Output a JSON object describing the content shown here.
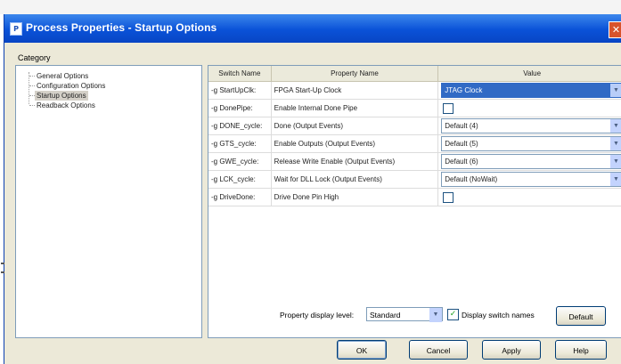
{
  "window": {
    "title": "Process Properties - Startup Options",
    "close_label": "✕"
  },
  "category": {
    "label": "Category",
    "items": [
      {
        "label": "General Options",
        "selected": false
      },
      {
        "label": "Configuration Options",
        "selected": false
      },
      {
        "label": "Startup Options",
        "selected": true
      },
      {
        "label": "Readback Options",
        "selected": false
      }
    ]
  },
  "grid": {
    "headers": {
      "switch_name": "Switch Name",
      "property_name": "Property Name",
      "value": "Value"
    },
    "rows": [
      {
        "switch": "-g StartUpClk:",
        "property": "FPGA Start-Up Clock",
        "value_type": "select",
        "value": "JTAG Clock",
        "highlighted": true
      },
      {
        "switch": "-g DonePipe:",
        "property": "Enable Internal Done Pipe",
        "value_type": "checkbox",
        "checked": false
      },
      {
        "switch": "-g DONE_cycle:",
        "property": "Done (Output Events)",
        "value_type": "select",
        "value": "Default (4)"
      },
      {
        "switch": "-g GTS_cycle:",
        "property": "Enable Outputs (Output Events)",
        "value_type": "select",
        "value": "Default (5)"
      },
      {
        "switch": "-g GWE_cycle:",
        "property": "Release Write Enable (Output Events)",
        "value_type": "select",
        "value": "Default (6)"
      },
      {
        "switch": "-g LCK_cycle:",
        "property": "Wait for DLL Lock (Output Events)",
        "value_type": "select",
        "value": "Default (NoWait)"
      },
      {
        "switch": "-g DriveDone:",
        "property": "Drive Done Pin High",
        "value_type": "checkbox",
        "checked": false
      }
    ]
  },
  "footer": {
    "display_level_label": "Property display level:",
    "display_level_value": "Standard",
    "display_switch_names_label": "Display switch names",
    "display_switch_names_checked": true,
    "default_button": "Default",
    "ok_button": "OK",
    "cancel_button": "Cancel",
    "apply_button": "Apply",
    "help_button": "Help"
  },
  "colors": {
    "title_bar": "#0a52d8",
    "selection": "#316ac5",
    "dialog_bg": "#ece9d8"
  }
}
